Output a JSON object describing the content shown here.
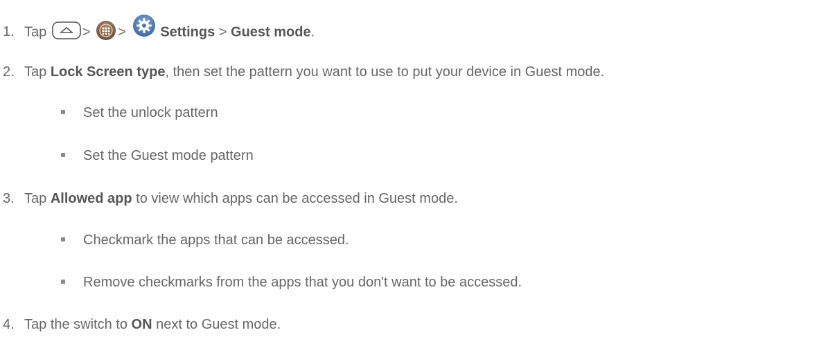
{
  "steps": [
    {
      "num": "1.",
      "tap": "Tap",
      "sep1": ">",
      "sep2": ">",
      "settings": "Settings",
      "sep3": ">",
      "guest": "Guest mode",
      "end": "."
    },
    {
      "num": "2.",
      "pre": "Tap",
      "bold": "Lock Screen type",
      "post": ", then set the pattern you want to use to put your device in Guest mode."
    },
    {
      "num": "3.",
      "pre": "Tap",
      "bold": "Allowed app",
      "post": "to view which apps can be accessed in Guest mode."
    },
    {
      "num": "4.",
      "pre": "Tap the switch to",
      "bold": "ON",
      "post": "next to Guest mode."
    }
  ],
  "sub_items": {
    "step2": [
      "Set the unlock pattern",
      "Set the Guest mode pattern"
    ],
    "step3": [
      "Checkmark the apps that can be accessed.",
      "Remove checkmarks from the apps that you don't want to be accessed."
    ]
  },
  "icons": {
    "home": "home-key-icon",
    "apps": "apps-icon",
    "settings": "settings-gear-icon"
  },
  "colors": {
    "text": "#666666",
    "bold_text": "#555555",
    "bullet": "#8a8a8a",
    "apps_icon": "#8f6a4d",
    "gear_icon": "#4f78b0"
  }
}
